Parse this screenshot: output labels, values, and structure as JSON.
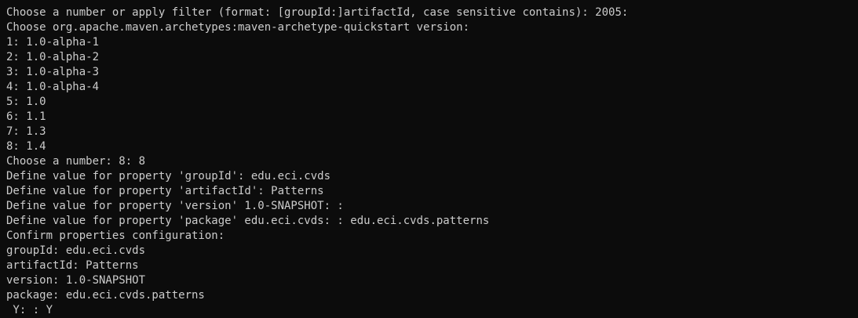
{
  "terminal": {
    "lines": [
      "Choose a number or apply filter (format: [groupId:]artifactId, case sensitive contains): 2005:",
      "Choose org.apache.maven.archetypes:maven-archetype-quickstart version:",
      "1: 1.0-alpha-1",
      "2: 1.0-alpha-2",
      "3: 1.0-alpha-3",
      "4: 1.0-alpha-4",
      "5: 1.0",
      "6: 1.1",
      "7: 1.3",
      "8: 1.4",
      "Choose a number: 8: 8",
      "Define value for property 'groupId': edu.eci.cvds",
      "Define value for property 'artifactId': Patterns",
      "Define value for property 'version' 1.0-SNAPSHOT: :",
      "Define value for property 'package' edu.eci.cvds: : edu.eci.cvds.patterns",
      "Confirm properties configuration:",
      "groupId: edu.eci.cvds",
      "artifactId: Patterns",
      "version: 1.0-SNAPSHOT",
      "package: edu.eci.cvds.patterns",
      " Y: : Y"
    ]
  }
}
